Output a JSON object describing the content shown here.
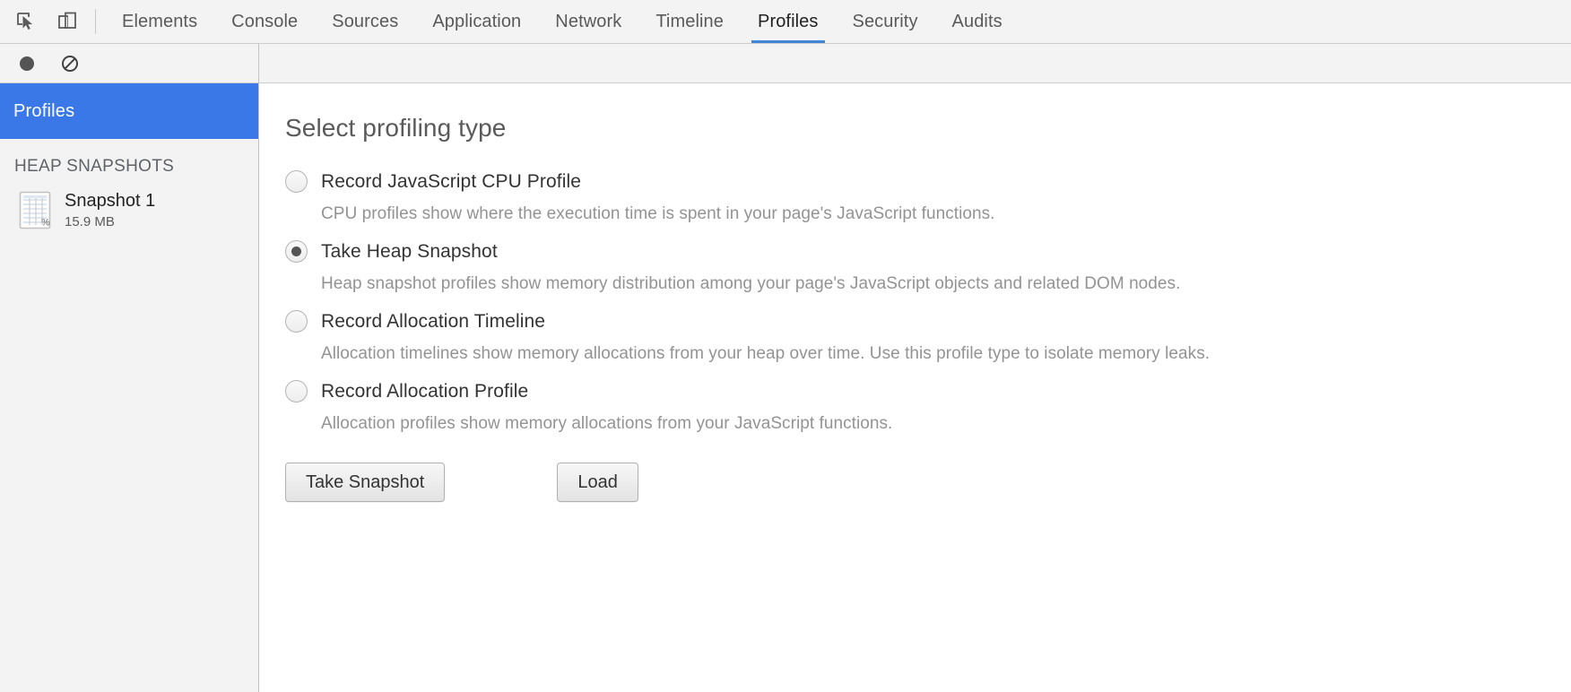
{
  "toolbar": {
    "inspect_icon": "inspect-cursor-icon",
    "device_icon": "device-toolbar-icon",
    "tabs": [
      {
        "label": "Elements",
        "active": false
      },
      {
        "label": "Console",
        "active": false
      },
      {
        "label": "Sources",
        "active": false
      },
      {
        "label": "Application",
        "active": false
      },
      {
        "label": "Network",
        "active": false
      },
      {
        "label": "Timeline",
        "active": false
      },
      {
        "label": "Profiles",
        "active": true
      },
      {
        "label": "Security",
        "active": false
      },
      {
        "label": "Audits",
        "active": false
      }
    ],
    "active_tab_indicator_color": "#4285d6"
  },
  "subtoolbar": {
    "record_icon": "record-circle-icon",
    "clear_icon": "clear-no-entry-icon"
  },
  "sidebar": {
    "header_label": "Profiles",
    "header_color": "#3b78e7",
    "section_title": "HEAP SNAPSHOTS",
    "snapshots": [
      {
        "icon": "heap-snapshot-grid-icon",
        "title": "Snapshot 1",
        "size": "15.9 MB"
      }
    ]
  },
  "main": {
    "title": "Select profiling type",
    "options": [
      {
        "label": "Record JavaScript CPU Profile",
        "description": "CPU profiles show where the execution time is spent in your page's JavaScript functions.",
        "selected": false
      },
      {
        "label": "Take Heap Snapshot",
        "description": "Heap snapshot profiles show memory distribution among your page's JavaScript objects and related DOM nodes.",
        "selected": true
      },
      {
        "label": "Record Allocation Timeline",
        "description": "Allocation timelines show memory allocations from your heap over time. Use this profile type to isolate memory leaks.",
        "selected": false
      },
      {
        "label": "Record Allocation Profile",
        "description": "Allocation profiles show memory allocations from your JavaScript functions.",
        "selected": false
      }
    ],
    "primary_button": "Take Snapshot",
    "secondary_button": "Load"
  }
}
